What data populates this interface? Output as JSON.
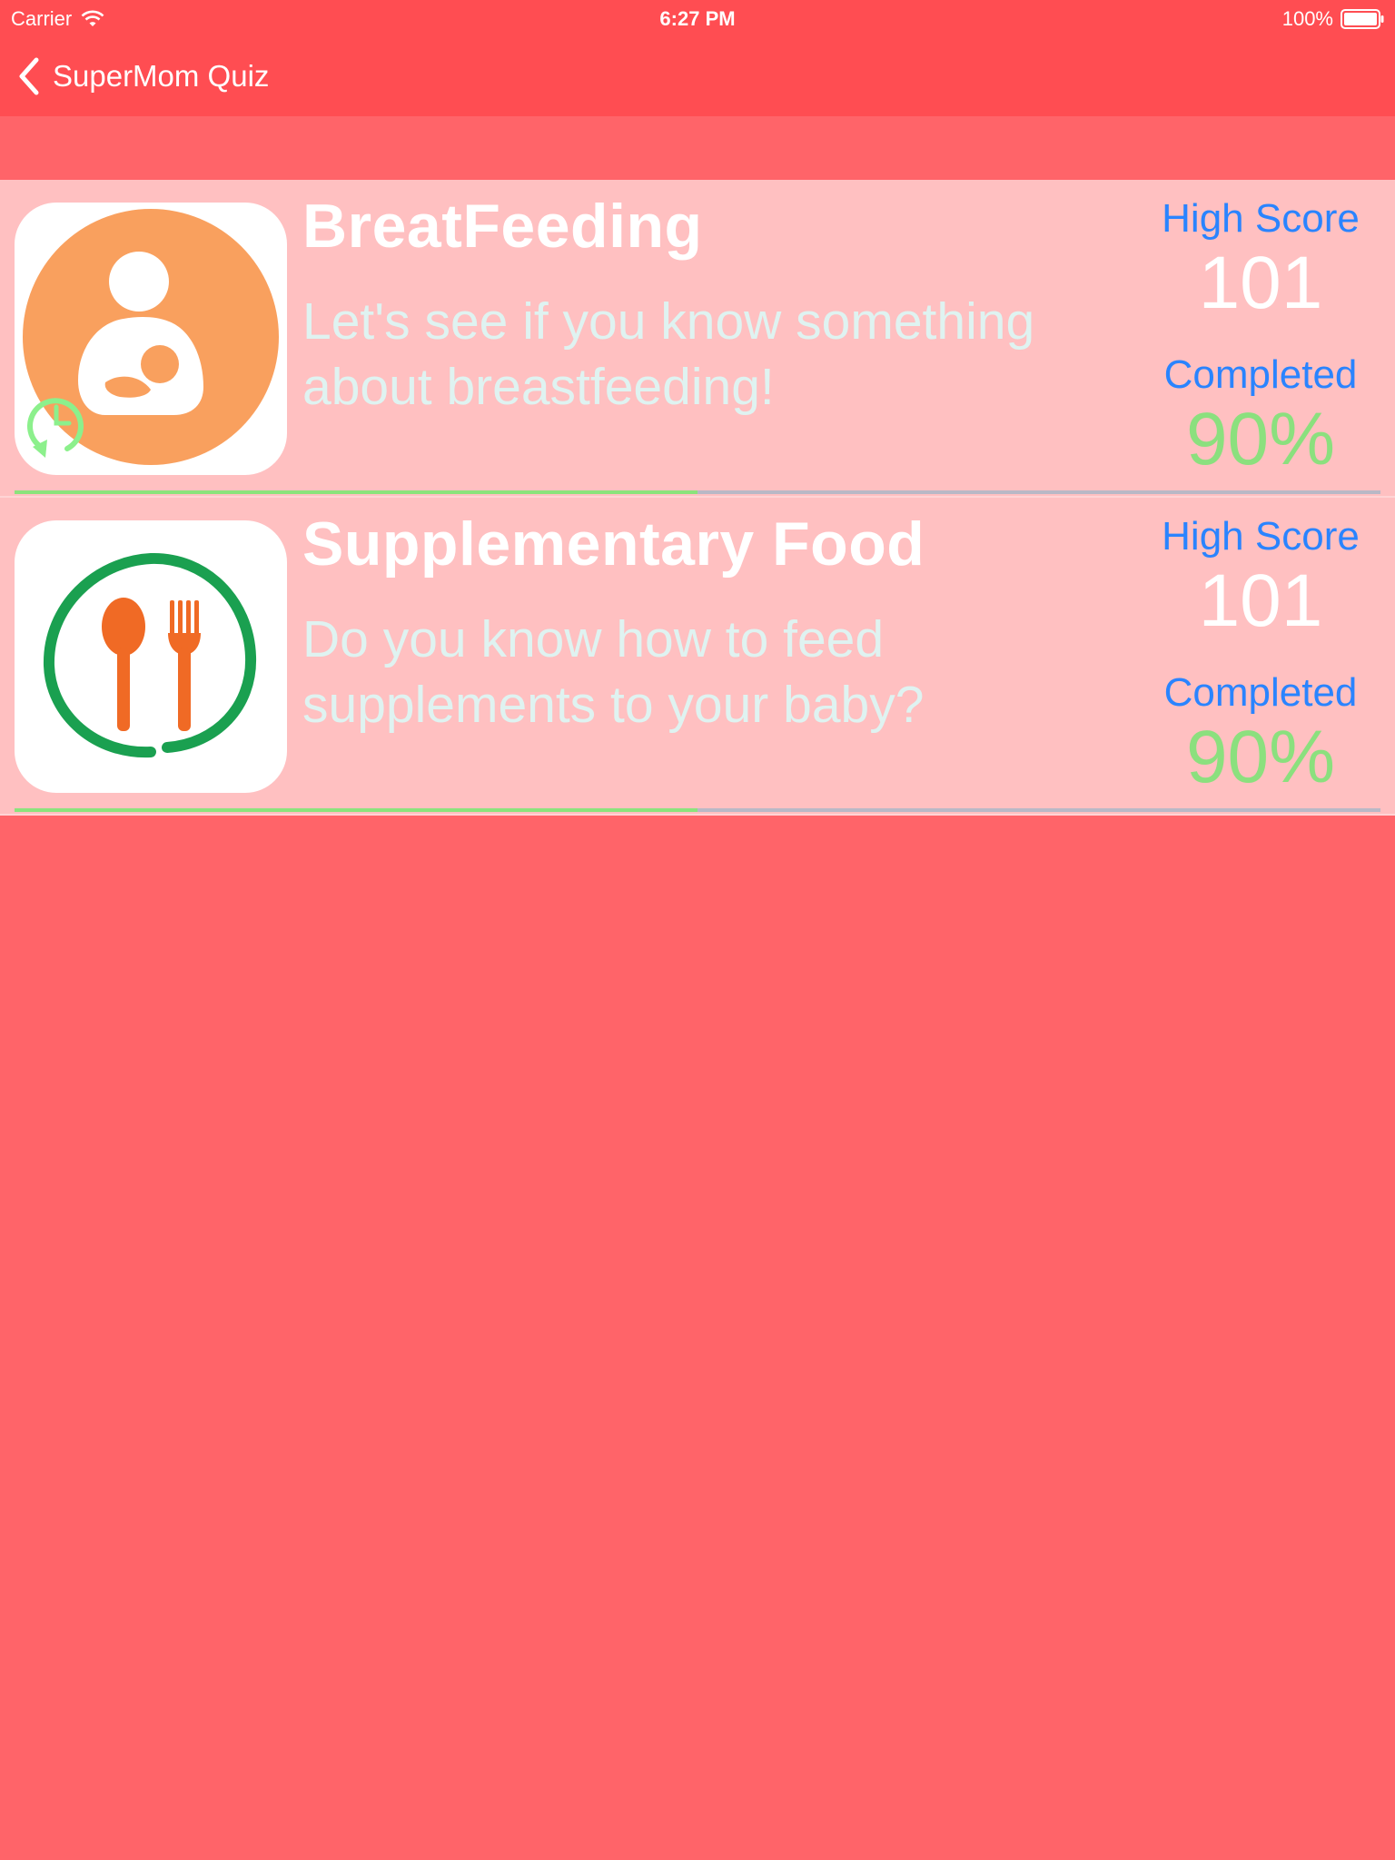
{
  "status_bar": {
    "carrier": "Carrier",
    "time": "6:27 PM",
    "battery": "100%",
    "icons": [
      "wifi-icon",
      "battery-icon"
    ]
  },
  "nav": {
    "back_label": "SuperMom Quiz",
    "back_icon": "chevron-left-icon"
  },
  "colors": {
    "nav_bg": "#ff4d52",
    "page_bg": "#ff6469",
    "row_bg": "#ffc0c1",
    "label_blue": "#2a84ff",
    "completed_green": "#8be07e",
    "progress_track": "#b9b8c6"
  },
  "quizzes": [
    {
      "title": "BreatFeeding",
      "description": "Let's see if you know something about breastfeeding!",
      "icon": "breastfeeding-icon",
      "badge_icon": "replay-clock-icon",
      "high_score_label": "High Score",
      "high_score": "101",
      "completed_label": "Completed",
      "completed": "90%",
      "progress_fraction": 0.5
    },
    {
      "title": "Supplementary Food",
      "description": "Do you know how to feed supplements to your baby?",
      "icon": "spoon-fork-icon",
      "high_score_label": "High Score",
      "high_score": "101",
      "completed_label": "Completed",
      "completed": "90%",
      "progress_fraction": 0.5
    }
  ]
}
